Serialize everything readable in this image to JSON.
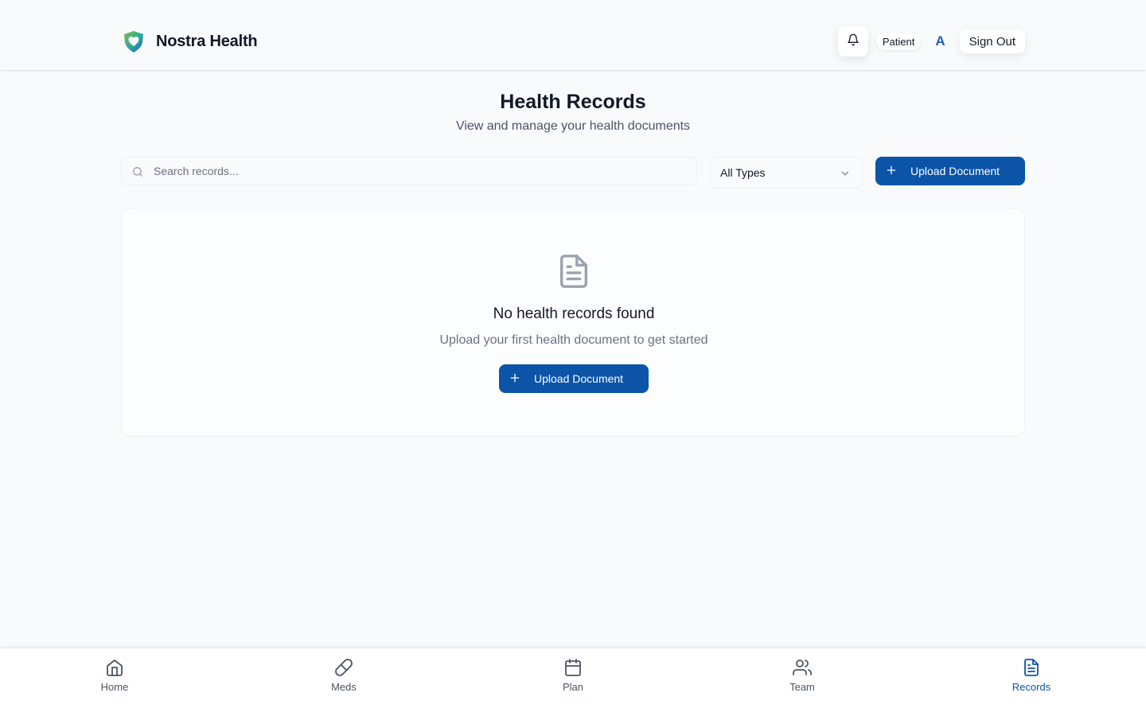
{
  "header": {
    "brand_name": "Nostra Health",
    "role_badge": "Patient",
    "avatar_initial": "A",
    "sign_out_label": "Sign Out"
  },
  "page": {
    "title": "Health Records",
    "subtitle": "View and manage your health documents"
  },
  "toolbar": {
    "search_placeholder": "Search records...",
    "type_filter_value": "All Types",
    "upload_label": "Upload Document"
  },
  "empty_state": {
    "title": "No health records found",
    "subtitle": "Upload your first health document to get started",
    "upload_label": "Upload Document"
  },
  "bottom_nav": {
    "items": [
      {
        "label": "Home",
        "icon": "home-icon"
      },
      {
        "label": "Meds",
        "icon": "pill-icon"
      },
      {
        "label": "Plan",
        "icon": "calendar-icon"
      },
      {
        "label": "Team",
        "icon": "users-icon"
      },
      {
        "label": "Records",
        "icon": "file-text-icon"
      }
    ],
    "active": "Records"
  },
  "colors": {
    "primary": "#0b54a8",
    "background": "#f8fafc",
    "active_nav": "#0b54a8",
    "muted_text": "#6b7280"
  }
}
